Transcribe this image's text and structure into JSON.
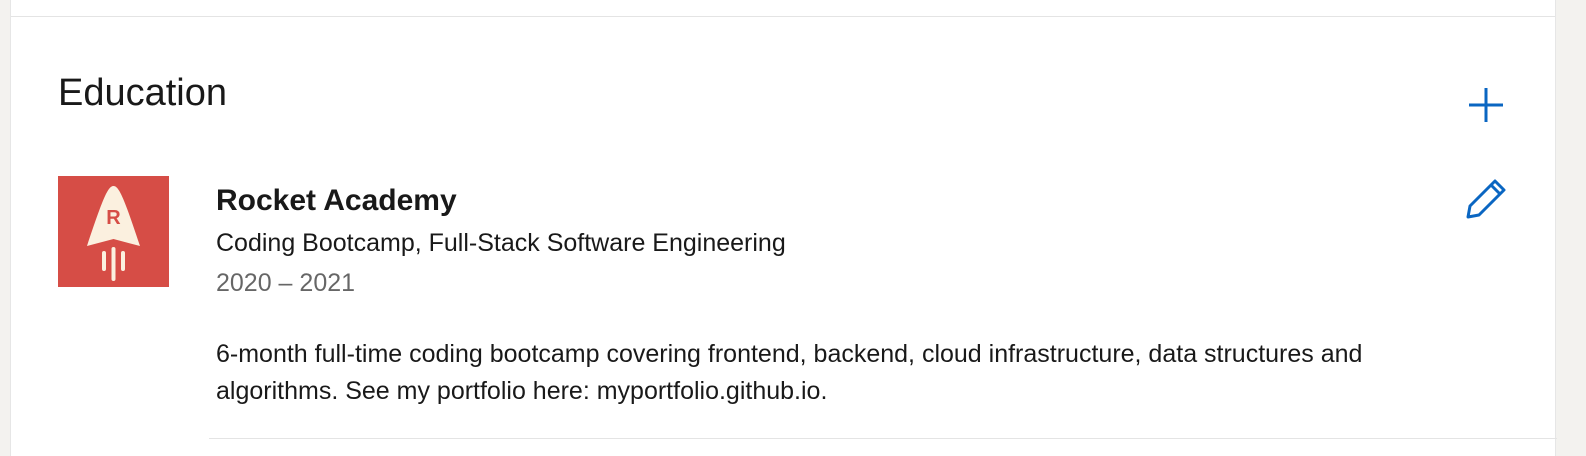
{
  "section": {
    "title": "Education"
  },
  "entry": {
    "school": "Rocket Academy",
    "logo_letter": "R",
    "degree": "Coding Bootcamp, Full-Stack Software Engineering",
    "dates": "2020 – 2021",
    "description": "6-month full-time coding bootcamp covering frontend, backend, cloud infrastructure, data structures and algorithms. See my portfolio here: myportfolio.github.io."
  },
  "icons": {
    "add": "plus-icon",
    "edit": "pencil-icon"
  },
  "colors": {
    "accent": "#0a66c2",
    "logo_bg": "#d64d46",
    "logo_fg": "#fbf0df"
  }
}
